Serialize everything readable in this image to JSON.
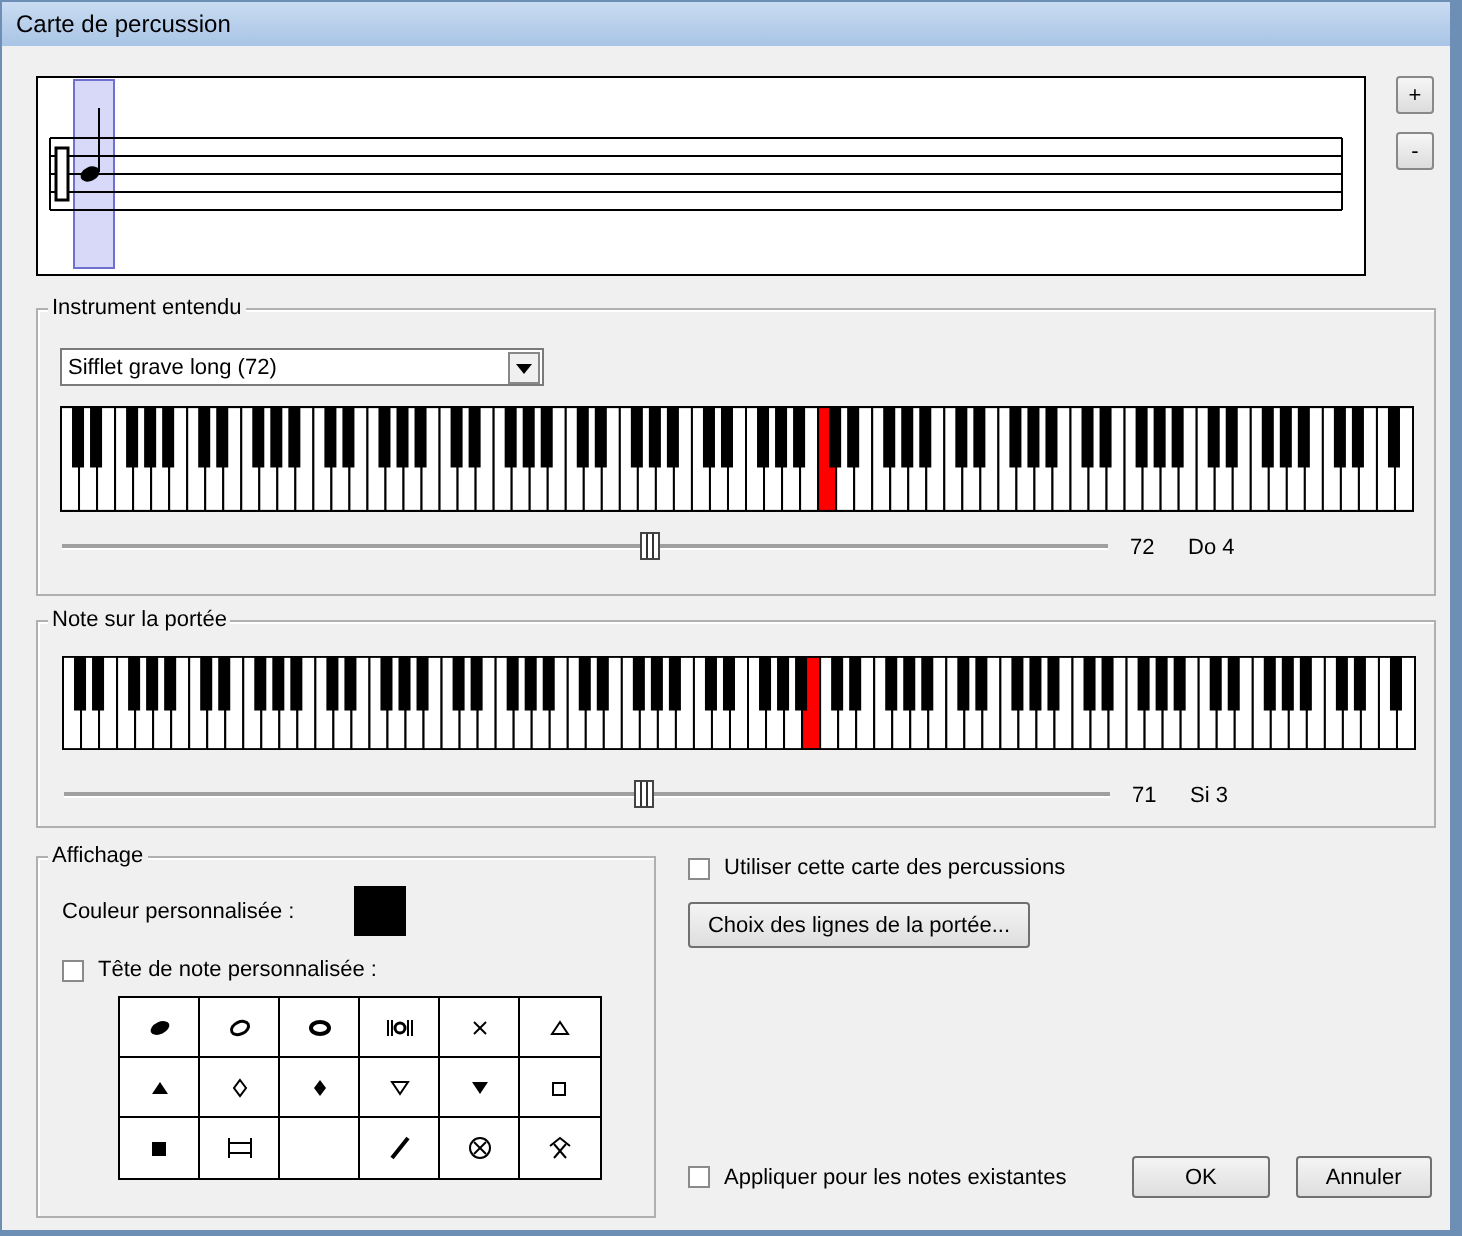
{
  "window": {
    "title": "Carte de percussion"
  },
  "staff": {
    "zoom_buttons": [
      "+",
      "-"
    ]
  },
  "heard_instrument": {
    "legend": "Instrument entendu",
    "dropdown": {
      "value": "Sifflet grave long (72)"
    },
    "slider": {
      "level": 0.567
    },
    "reading": "72",
    "note_name": "Do 4"
  },
  "staff_note": {
    "legend": "Note sur la portée",
    "slider": {
      "level": 0.559
    },
    "reading": "71",
    "note_name": "Si 3"
  },
  "display": {
    "legend": "Affichage",
    "color_label": "Couleur personnalisée :",
    "color": "#000000",
    "custom_head": {
      "label": "Tête de note personnalisée :",
      "checked": false
    },
    "noteheads": [
      {
        "kind": "filled-oval"
      },
      {
        "kind": "open-oval"
      },
      {
        "kind": "whole"
      },
      {
        "kind": "double-whole"
      },
      {
        "kind": "cross"
      },
      {
        "kind": "triangle-open"
      },
      {
        "kind": "triangle"
      },
      {
        "kind": "diamond-open"
      },
      {
        "kind": "diamond"
      },
      {
        "kind": "down-triangle-open"
      },
      {
        "kind": "down-triangle"
      },
      {
        "kind": "square-open"
      },
      {
        "kind": "square"
      },
      {
        "kind": "bracket"
      },
      {
        "kind": "blank"
      },
      {
        "kind": "slash"
      },
      {
        "kind": "circle-cross"
      },
      {
        "kind": "hat"
      }
    ]
  },
  "use_map": {
    "label": "Utiliser cette carte des percussions",
    "checked": false
  },
  "staff_lines_button": "Choix des lignes de la portée...",
  "apply_existing": {
    "label": "Appliquer pour les notes existantes",
    "checked": false
  },
  "buttons": [
    "OK",
    "Annuler"
  ]
}
